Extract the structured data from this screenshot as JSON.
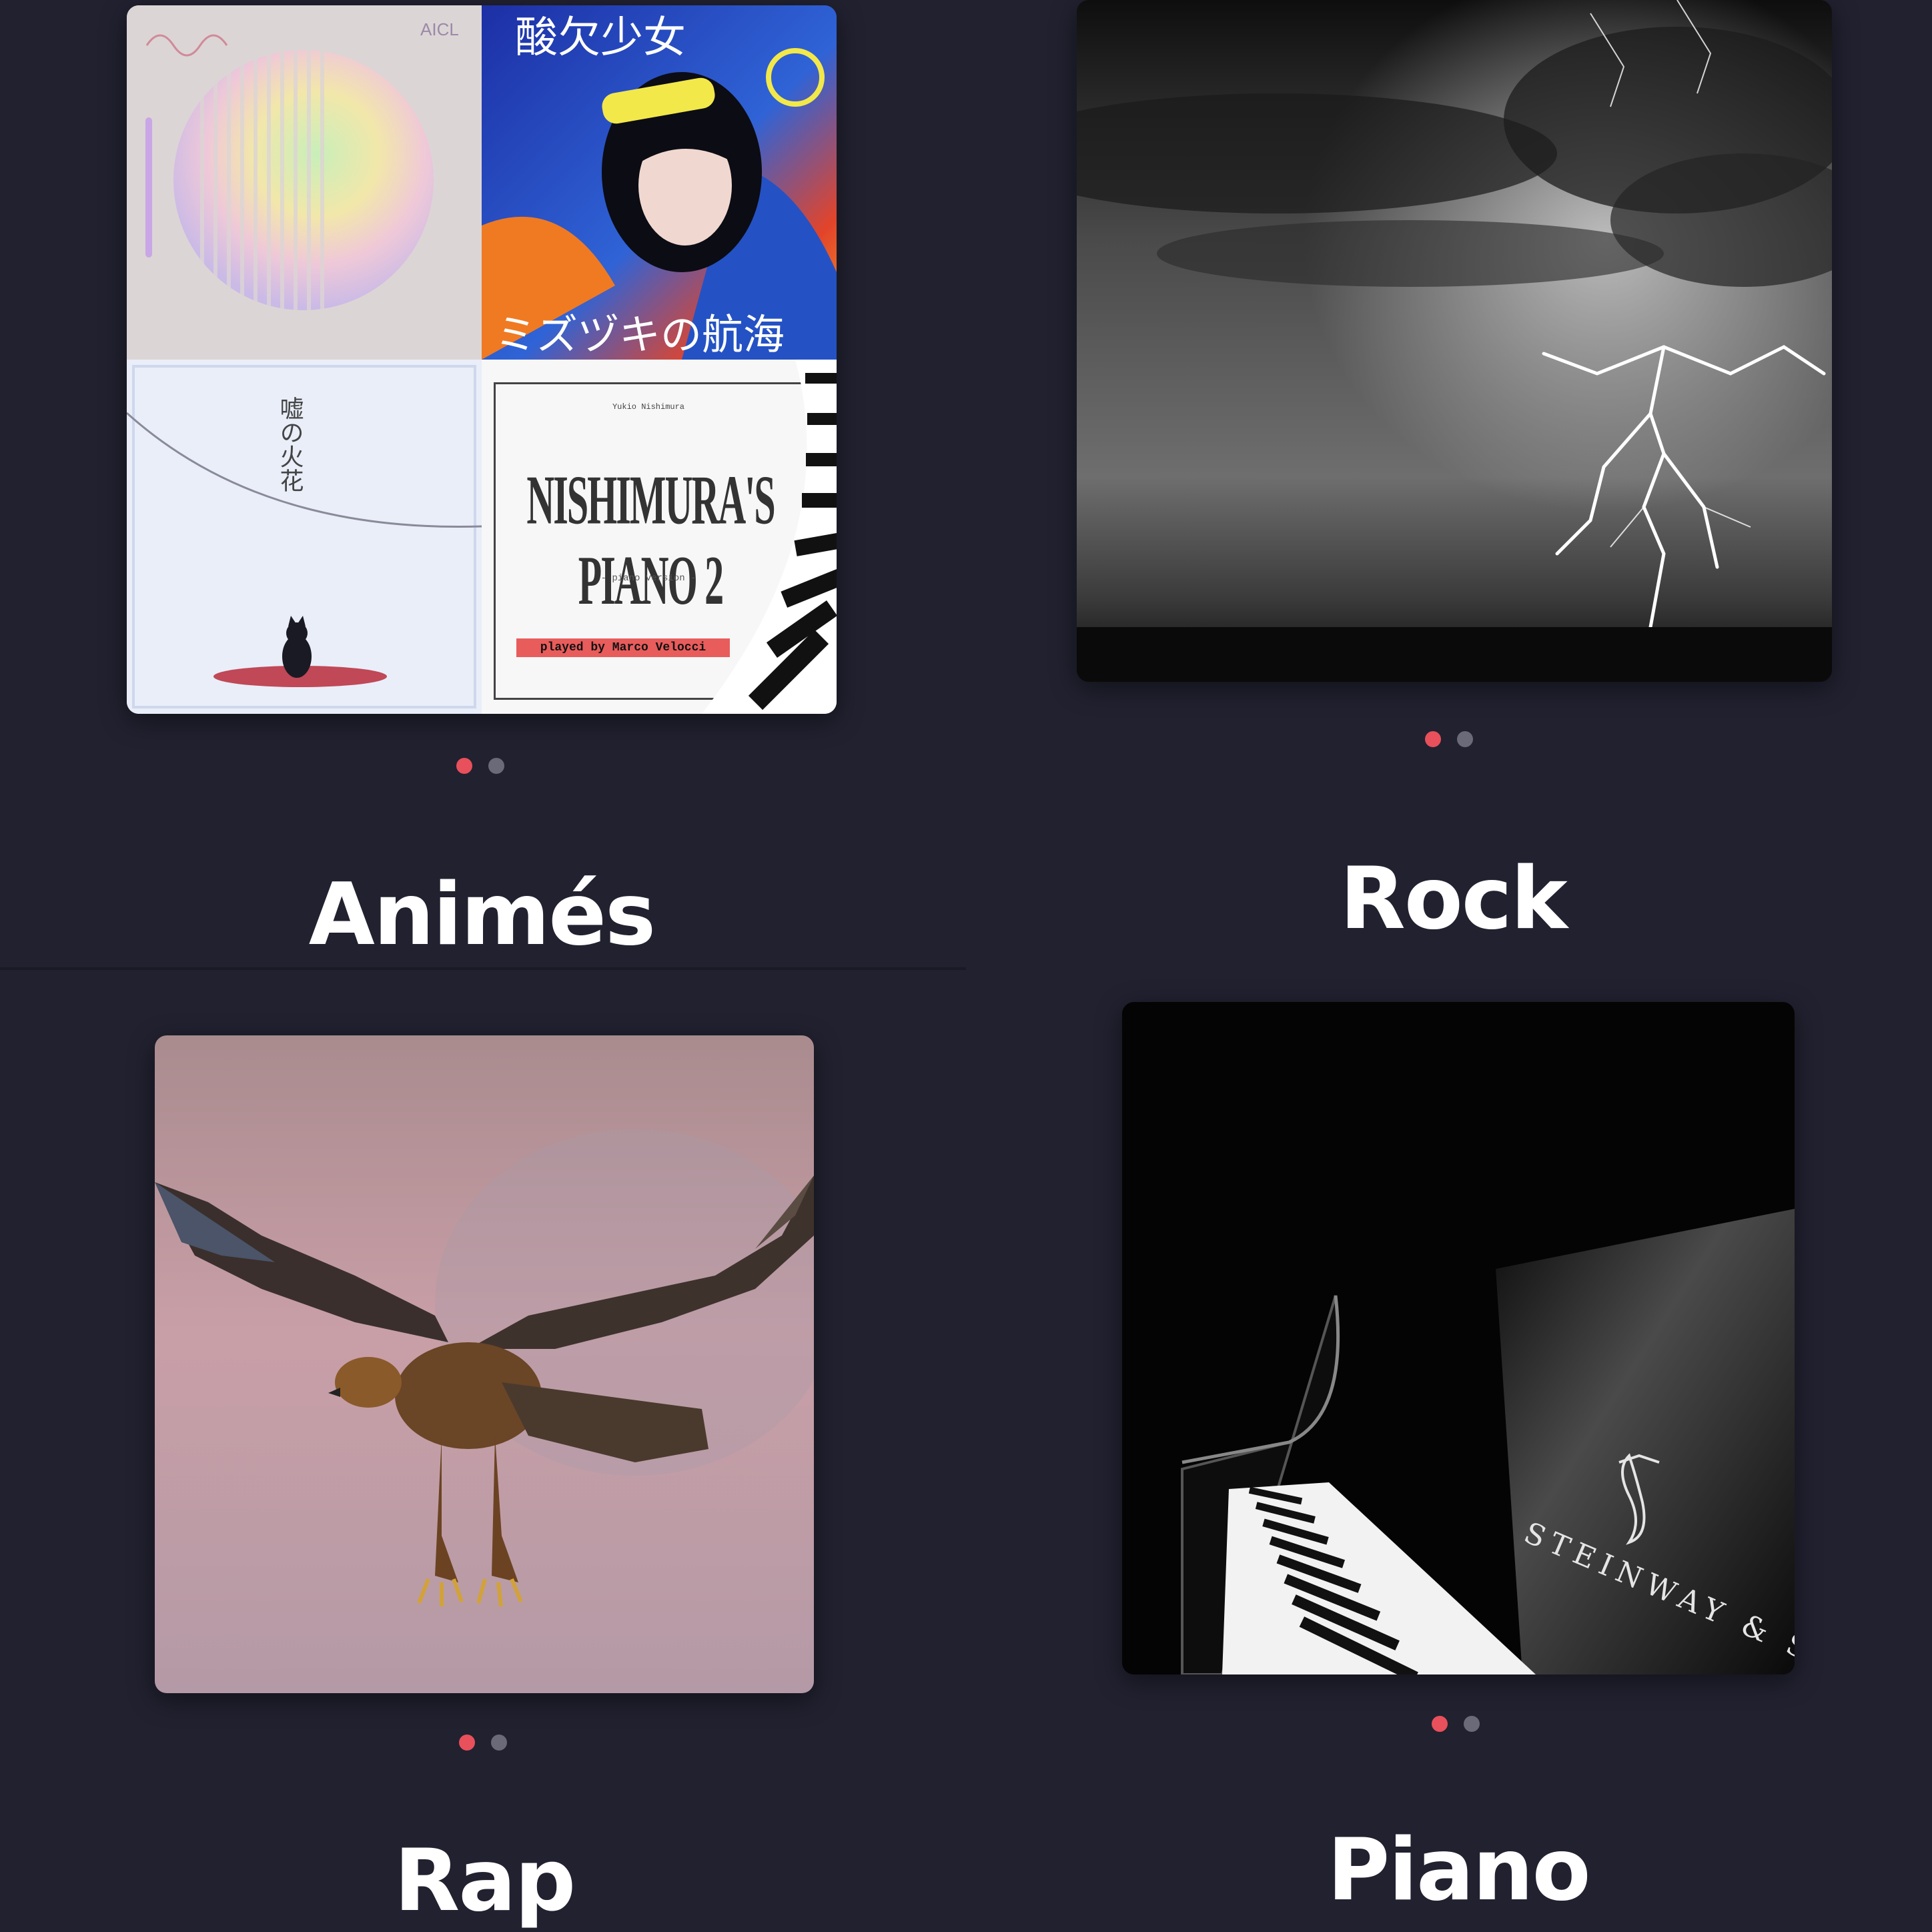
{
  "genres": [
    {
      "title": "Animés",
      "pagination": {
        "count": 2,
        "active": 1
      },
      "cover_art": {
        "type": "collage",
        "tiles": [
          {
            "name": "pastel-album",
            "text": "AICL"
          },
          {
            "name": "anime-girl-album",
            "text_top": "酸欠少女",
            "text_bottom": "ミズヅキの航海"
          },
          {
            "name": "cat-album",
            "text": "嘘の火花"
          },
          {
            "name": "piano-album",
            "text_top": "Yukio Nishimura",
            "title": "NISHIMURA'S PIANO 2",
            "subtitle": "- piano version -",
            "credit": "played by Marco Velocci"
          }
        ]
      }
    },
    {
      "title": "Rock",
      "pagination": {
        "count": 2,
        "active": 1
      },
      "cover_art": {
        "type": "photo",
        "subject": "lightning-storm"
      }
    },
    {
      "title": "Rap",
      "pagination": {
        "count": 2,
        "active": 1
      },
      "cover_art": {
        "type": "photo",
        "subject": "eagle-in-flight"
      }
    },
    {
      "title": "Piano",
      "pagination": {
        "count": 2,
        "active": 1
      },
      "cover_art": {
        "type": "photo",
        "subject": "grand-piano",
        "brand_text": "STEINWAY & SO"
      }
    }
  ],
  "colors": {
    "background": "#212130",
    "dot_active": "#e8505b",
    "dot_inactive": "#6a6a78",
    "title": "#ffffff"
  }
}
